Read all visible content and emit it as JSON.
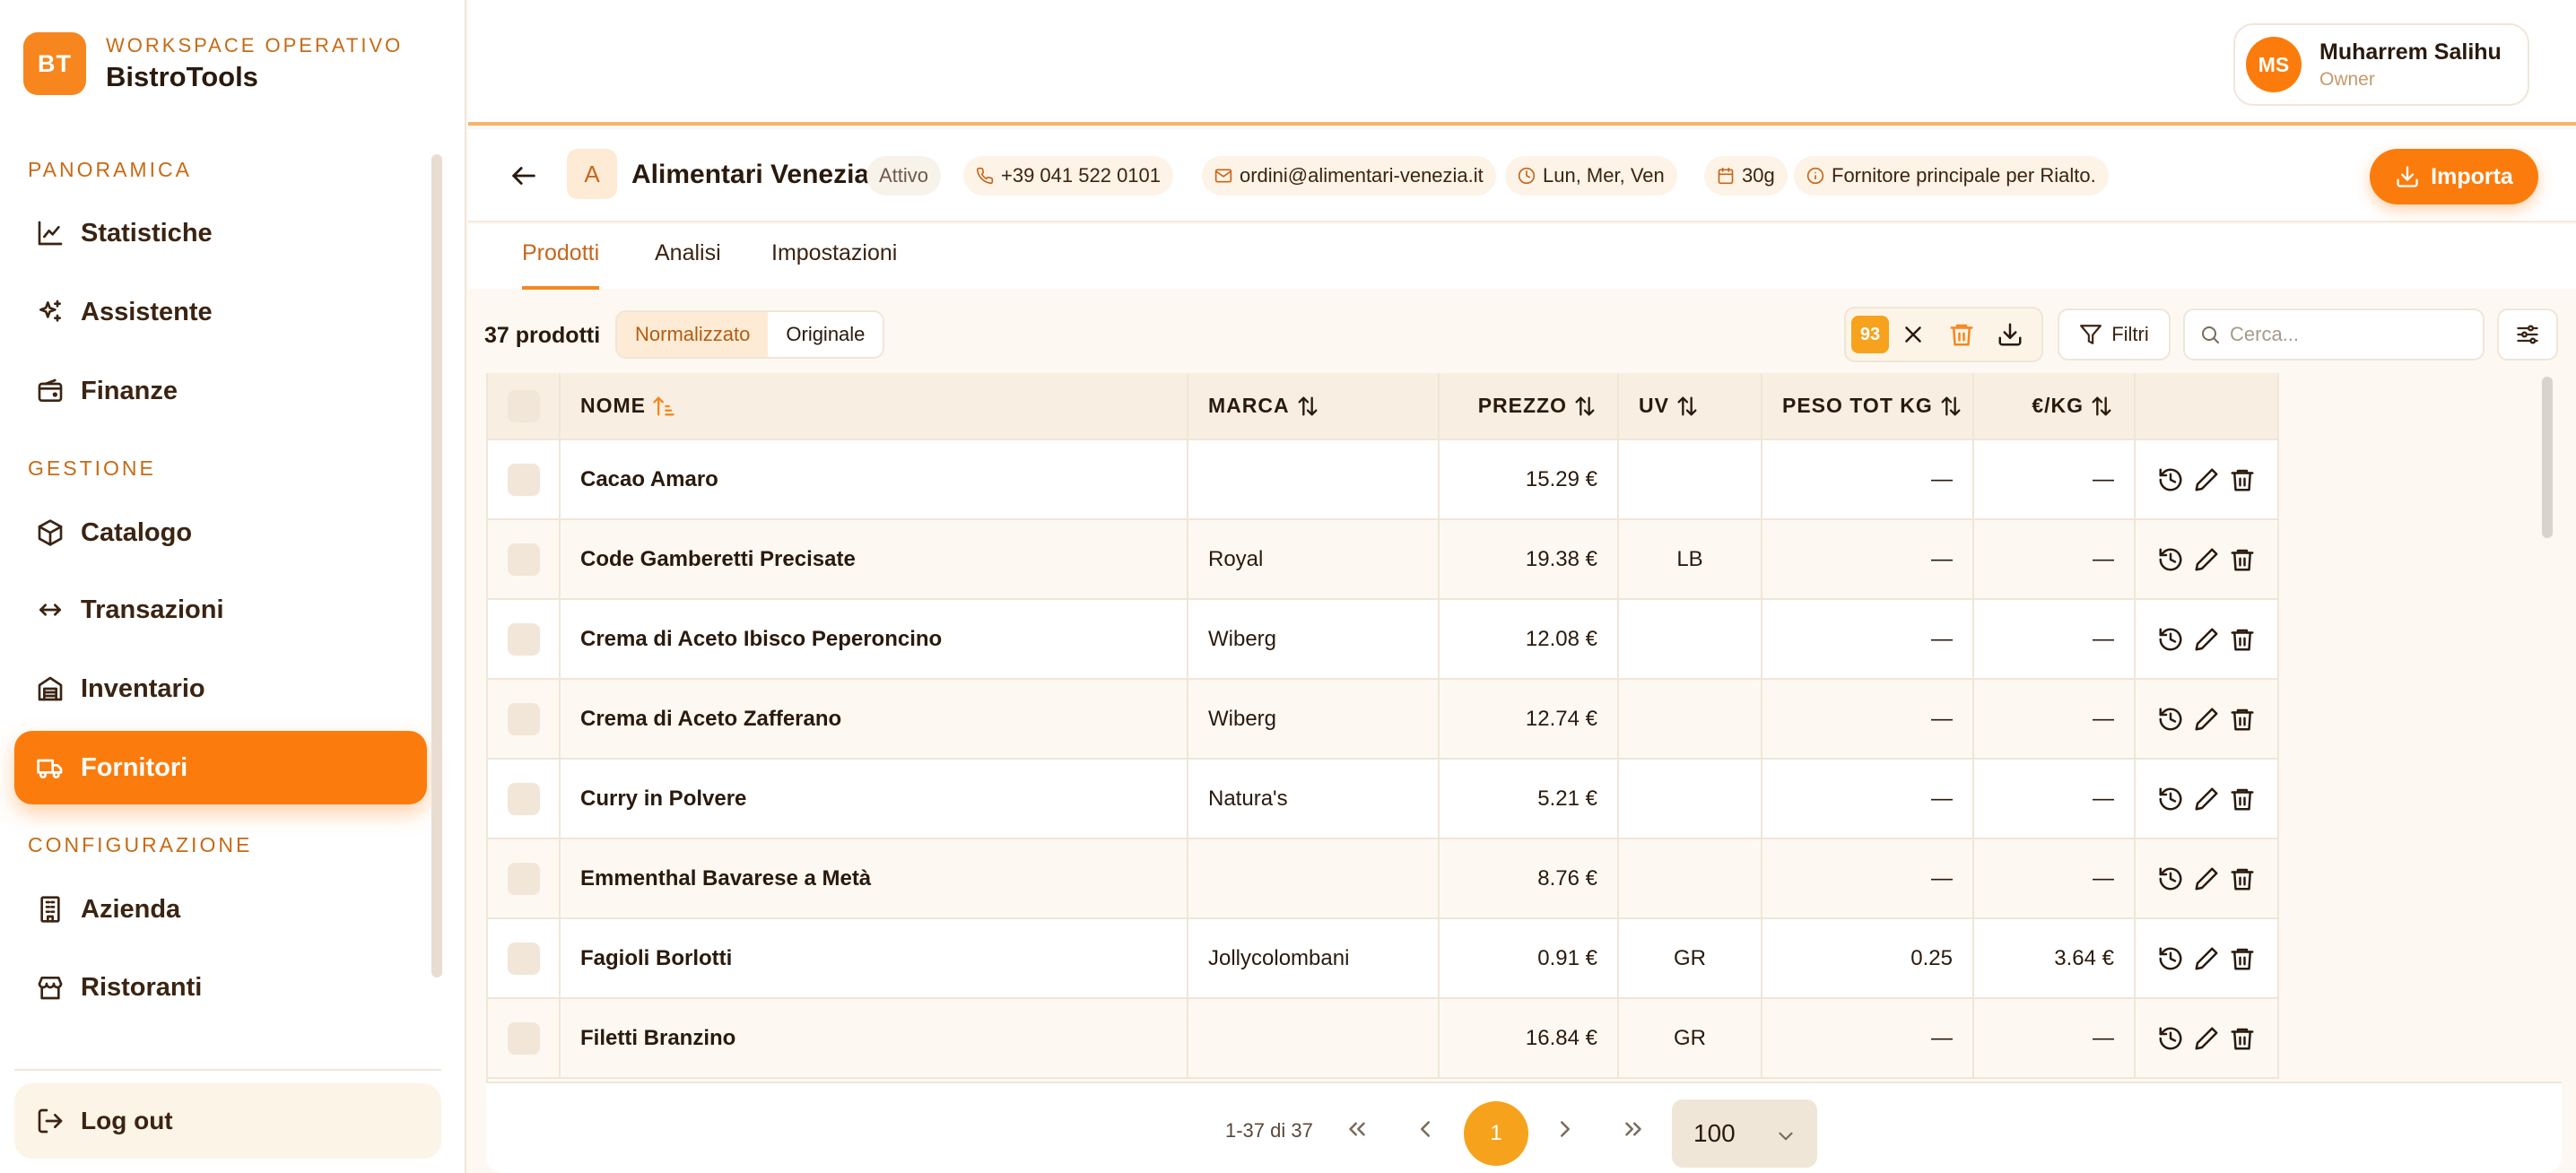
{
  "brand": {
    "logo": "BT",
    "subtitle": "WORKSPACE OPERATIVO",
    "name": "BistroTools"
  },
  "sidebar": {
    "sections": [
      {
        "label": "PANORAMICA"
      },
      {
        "label": "GESTIONE"
      },
      {
        "label": "CONFIGURAZIONE"
      }
    ],
    "items": [
      {
        "label": "Statistiche",
        "icon": "chart-line-icon"
      },
      {
        "label": "Assistente",
        "icon": "sparkles-icon"
      },
      {
        "label": "Finanze",
        "icon": "wallet-icon"
      },
      {
        "label": "Catalogo",
        "icon": "package-icon"
      },
      {
        "label": "Transazioni",
        "icon": "arrows-left-right-icon"
      },
      {
        "label": "Inventario",
        "icon": "warehouse-icon"
      },
      {
        "label": "Fornitori",
        "icon": "truck-icon",
        "active": true
      },
      {
        "label": "Azienda",
        "icon": "building-icon"
      },
      {
        "label": "Ristoranti",
        "icon": "store-icon"
      }
    ],
    "logout": "Log out"
  },
  "user": {
    "initials": "MS",
    "name": "Muharrem Salihu",
    "role": "Owner"
  },
  "supplier": {
    "initial": "A",
    "name": "Alimentari Venezia",
    "status": "Attivo",
    "phone": "+39 041 522 0101",
    "email": "ordini@alimentari-venezia.it",
    "days": "Lun, Mer, Ven",
    "terms": "30g",
    "note": "Fornitore principale per Rialto.",
    "import_label": "Importa"
  },
  "tabs": [
    {
      "label": "Prodotti",
      "active": true
    },
    {
      "label": "Analisi"
    },
    {
      "label": "Impostazioni"
    }
  ],
  "toolbar": {
    "count": "37 prodotti",
    "view_normalized": "Normalizzato",
    "view_original": "Originale",
    "selected_count": "93",
    "filter_label": "Filtri",
    "search_placeholder": "Cerca..."
  },
  "table": {
    "columns": [
      "NOME",
      "MARCA",
      "PREZZO",
      "UV",
      "PESO TOT KG",
      "€/KG"
    ],
    "rows": [
      {
        "name": "Cacao Amaro",
        "brand": "",
        "price": "15.29 €",
        "uv": "",
        "weight": "—",
        "perkg": "—"
      },
      {
        "name": "Code Gamberetti Precisate",
        "brand": "Royal",
        "price": "19.38 €",
        "uv": "LB",
        "weight": "—",
        "perkg": "—"
      },
      {
        "name": "Crema di Aceto Ibisco Peperoncino",
        "brand": "Wiberg",
        "price": "12.08 €",
        "uv": "",
        "weight": "—",
        "perkg": "—"
      },
      {
        "name": "Crema di Aceto Zafferano",
        "brand": "Wiberg",
        "price": "12.74 €",
        "uv": "",
        "weight": "—",
        "perkg": "—"
      },
      {
        "name": "Curry in Polvere",
        "brand": "Natura's",
        "price": "5.21 €",
        "uv": "",
        "weight": "—",
        "perkg": "—"
      },
      {
        "name": "Emmenthal Bavarese a Metà",
        "brand": "",
        "price": "8.76 €",
        "uv": "",
        "weight": "—",
        "perkg": "—"
      },
      {
        "name": "Fagioli Borlotti",
        "brand": "Jollycolombani",
        "price": "0.91 €",
        "uv": "GR",
        "weight": "0.25",
        "perkg": "3.64 €"
      },
      {
        "name": "Filetti Branzino",
        "brand": "",
        "price": "16.84 €",
        "uv": "GR",
        "weight": "—",
        "perkg": "—"
      }
    ]
  },
  "pagination": {
    "range": "1-37 di 37",
    "current_page": "1",
    "per_page": "100"
  },
  "colors": {
    "accent": "#fb7c0c",
    "accent_soft": "#fdebd6",
    "badge": "#f7a21c"
  }
}
